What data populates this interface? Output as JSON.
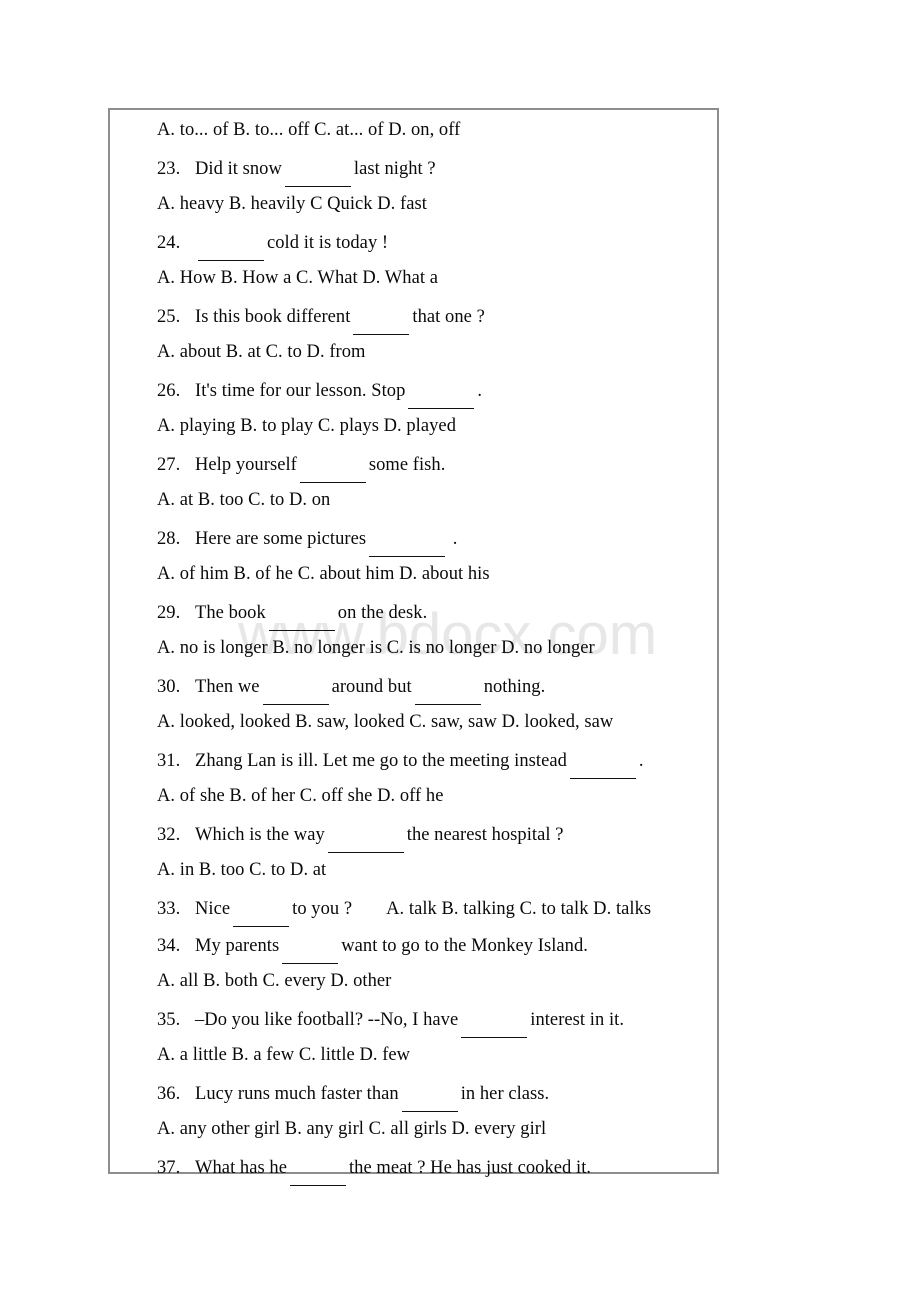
{
  "document": {
    "watermark": "www.bdocx.com",
    "border_color": "#8d8d8d",
    "text_color": "#0a0a0a",
    "watermark_color": "#e7e7e7",
    "background": "#ffffff"
  },
  "lines": [
    {
      "id": "opt-22",
      "kind": "options",
      "text": "A. to... of   B. to... off   C. at... of   D. on, off"
    },
    {
      "id": "q-23",
      "kind": "question",
      "number": "23.",
      "pre": "Did it snow",
      "blank": "b-lg",
      "post": "last night ?"
    },
    {
      "id": "opt-23",
      "kind": "options",
      "text": "A. heavy   B. heavily    C Quick    D. fast"
    },
    {
      "id": "q-24",
      "kind": "question",
      "number": "24.",
      "pre": "",
      "blank": "b-lg",
      "post": "cold it is today !"
    },
    {
      "id": "opt-24",
      "kind": "options",
      "text": "A. How   B. How a    C. What    D. What a"
    },
    {
      "id": "q-25",
      "kind": "question",
      "number": "25.",
      "pre": "Is this book different",
      "blank": "b-md",
      "post": "that one ?"
    },
    {
      "id": "opt-25",
      "kind": "options",
      "text": "A. about   B. at    C. to    D. from"
    },
    {
      "id": "q-26",
      "kind": "question",
      "number": "26.",
      "pre": "It's time for our lesson. Stop",
      "blank": "b-lg",
      "post": "."
    },
    {
      "id": "opt-26",
      "kind": "options",
      "text": "A. playing   B. to play   C. plays    D. played"
    },
    {
      "id": "q-27",
      "kind": "question",
      "number": "27.",
      "pre": "Help yourself",
      "blank": "b-lg",
      "post": "some fish."
    },
    {
      "id": "opt-27",
      "kind": "options",
      "text": "A. at    B. too   C. to    D. on"
    },
    {
      "id": "q-28",
      "kind": "question",
      "number": "28.",
      "pre": "Here are some pictures",
      "blank": "b-xl",
      "post": " ."
    },
    {
      "id": "opt-28",
      "kind": "options",
      "text": "A. of him    B. of he    C. about him   D. about his"
    },
    {
      "id": "q-29",
      "kind": "question",
      "number": "29.",
      "pre": "The book",
      "blank": "b-lg",
      "post": "on the desk."
    },
    {
      "id": "opt-29",
      "kind": "options",
      "text": "A. no is longer   B. no longer is   C. is no longer   D. no longer"
    },
    {
      "id": "q-30",
      "kind": "question2",
      "number": "30.",
      "pre": "Then we",
      "blank": "b-lg",
      "mid": "around but",
      "blank2": "b-lg",
      "post": "nothing."
    },
    {
      "id": "opt-30",
      "kind": "options",
      "text": "A. looked, looked   B. saw, looked  C. saw, saw  D. looked, saw"
    },
    {
      "id": "q-31",
      "kind": "question",
      "number": "31.",
      "pre": "Zhang Lan is ill. Let me go to the meeting instead",
      "blank": "b-lg",
      "post": "."
    },
    {
      "id": "opt-31",
      "kind": "options",
      "text": "A. of she   B. of her    C. off she   D. off he"
    },
    {
      "id": "q-32",
      "kind": "question",
      "number": "32.",
      "pre": "Which is the way",
      "blank": "b-xl",
      "post": "the nearest hospital ?"
    },
    {
      "id": "opt-32",
      "kind": "options",
      "text": "A. in   B. too    C. to    D. at"
    },
    {
      "id": "q-33",
      "kind": "question-inline",
      "number": "33.",
      "pre": "Nice",
      "blank": "b-md",
      "post": "to you ?",
      "options": "A. talk    B. talking   C. to talk   D. talks"
    },
    {
      "id": "q-34",
      "kind": "question",
      "number": "34.",
      "pre": "My parents",
      "blank": "b-md",
      "post": "want to go to the Monkey Island."
    },
    {
      "id": "opt-34",
      "kind": "options",
      "text": "A. all    B. both    C. every   D. other"
    },
    {
      "id": "q-35",
      "kind": "question",
      "number": "35.",
      "pre": "–Do you like football?  --No, I have",
      "blank": "b-lg",
      "post": "interest in it."
    },
    {
      "id": "opt-35",
      "kind": "options",
      "text": "A. a little   B. a few   C. little  D. few"
    },
    {
      "id": "q-36",
      "kind": "question",
      "number": "36.",
      "pre": "Lucy runs much faster than",
      "blank": "b-md",
      "post": "in her class."
    },
    {
      "id": "opt-36",
      "kind": "options",
      "text": "A. any other girl   B. any girl   C. all girls  D. every girl"
    },
    {
      "id": "q-37",
      "kind": "question",
      "number": "37.",
      "pre": "What has he",
      "blank": "b-md",
      "post": "the meat ?   He has just cooked it."
    }
  ]
}
